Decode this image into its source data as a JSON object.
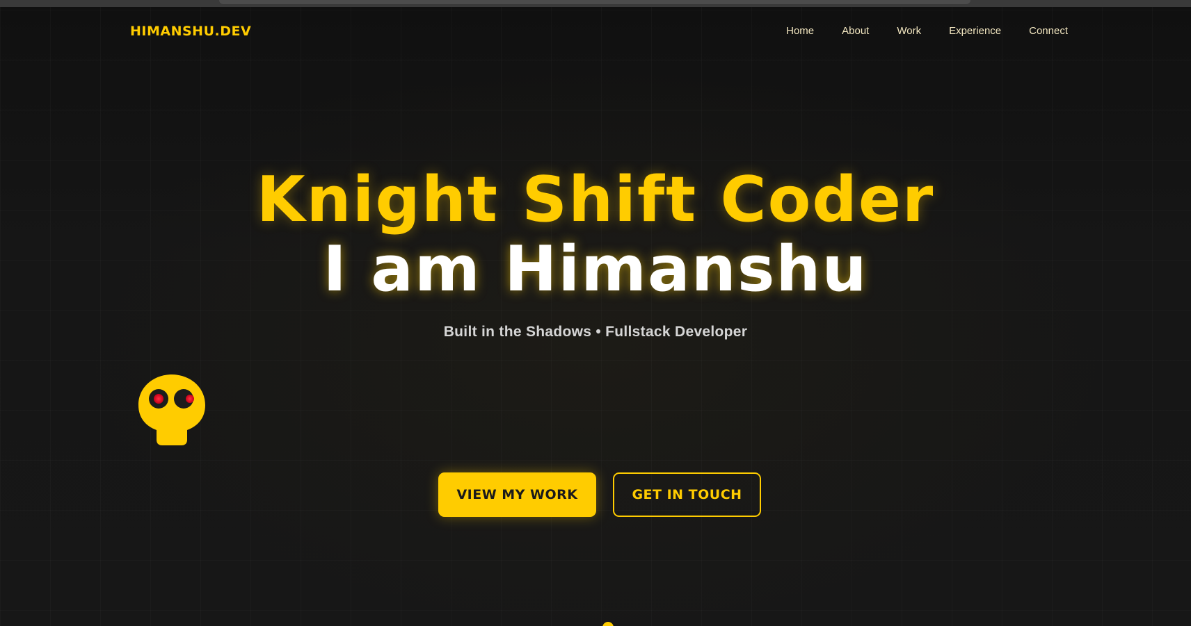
{
  "nav": {
    "brand": "HIMANSHU.DEV",
    "links": [
      {
        "label": "Home"
      },
      {
        "label": "About"
      },
      {
        "label": "Work"
      },
      {
        "label": "Experience"
      },
      {
        "label": "Connect"
      }
    ]
  },
  "hero": {
    "title_line1": "Knight Shift Coder",
    "title_line2": "I am Himanshu",
    "subtitle": "Built in the Shadows • Fullstack Developer",
    "mascot_icon": "skull-mascot-icon",
    "primary_button": "VIEW MY WORK",
    "secondary_button": "GET IN TOUCH"
  },
  "colors": {
    "accent": "#ffcc00",
    "background": "#141414",
    "eye": "#e0102a"
  }
}
